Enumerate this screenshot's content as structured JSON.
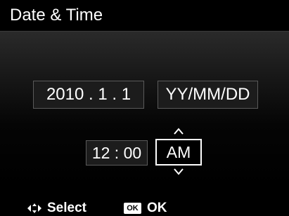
{
  "header": {
    "title": "Date & Time"
  },
  "date_time": {
    "date_value": "2010 .  1 .  1",
    "date_format": "YY/MM/DD",
    "time_value": "12 : 00",
    "meridiem": "AM"
  },
  "footer": {
    "select_label": "Select",
    "ok_badge": "OK",
    "ok_label": "OK"
  },
  "icons": {
    "navigate": "left-right-arrows-icon",
    "ok": "ok-button-icon",
    "up": "chevron-up-icon",
    "down": "chevron-down-icon"
  },
  "colors": {
    "background": "#000000",
    "text": "#ffffff",
    "field": "#1c1c1c",
    "field_border": "#5a5a5a",
    "selected_border": "#ffffff"
  }
}
